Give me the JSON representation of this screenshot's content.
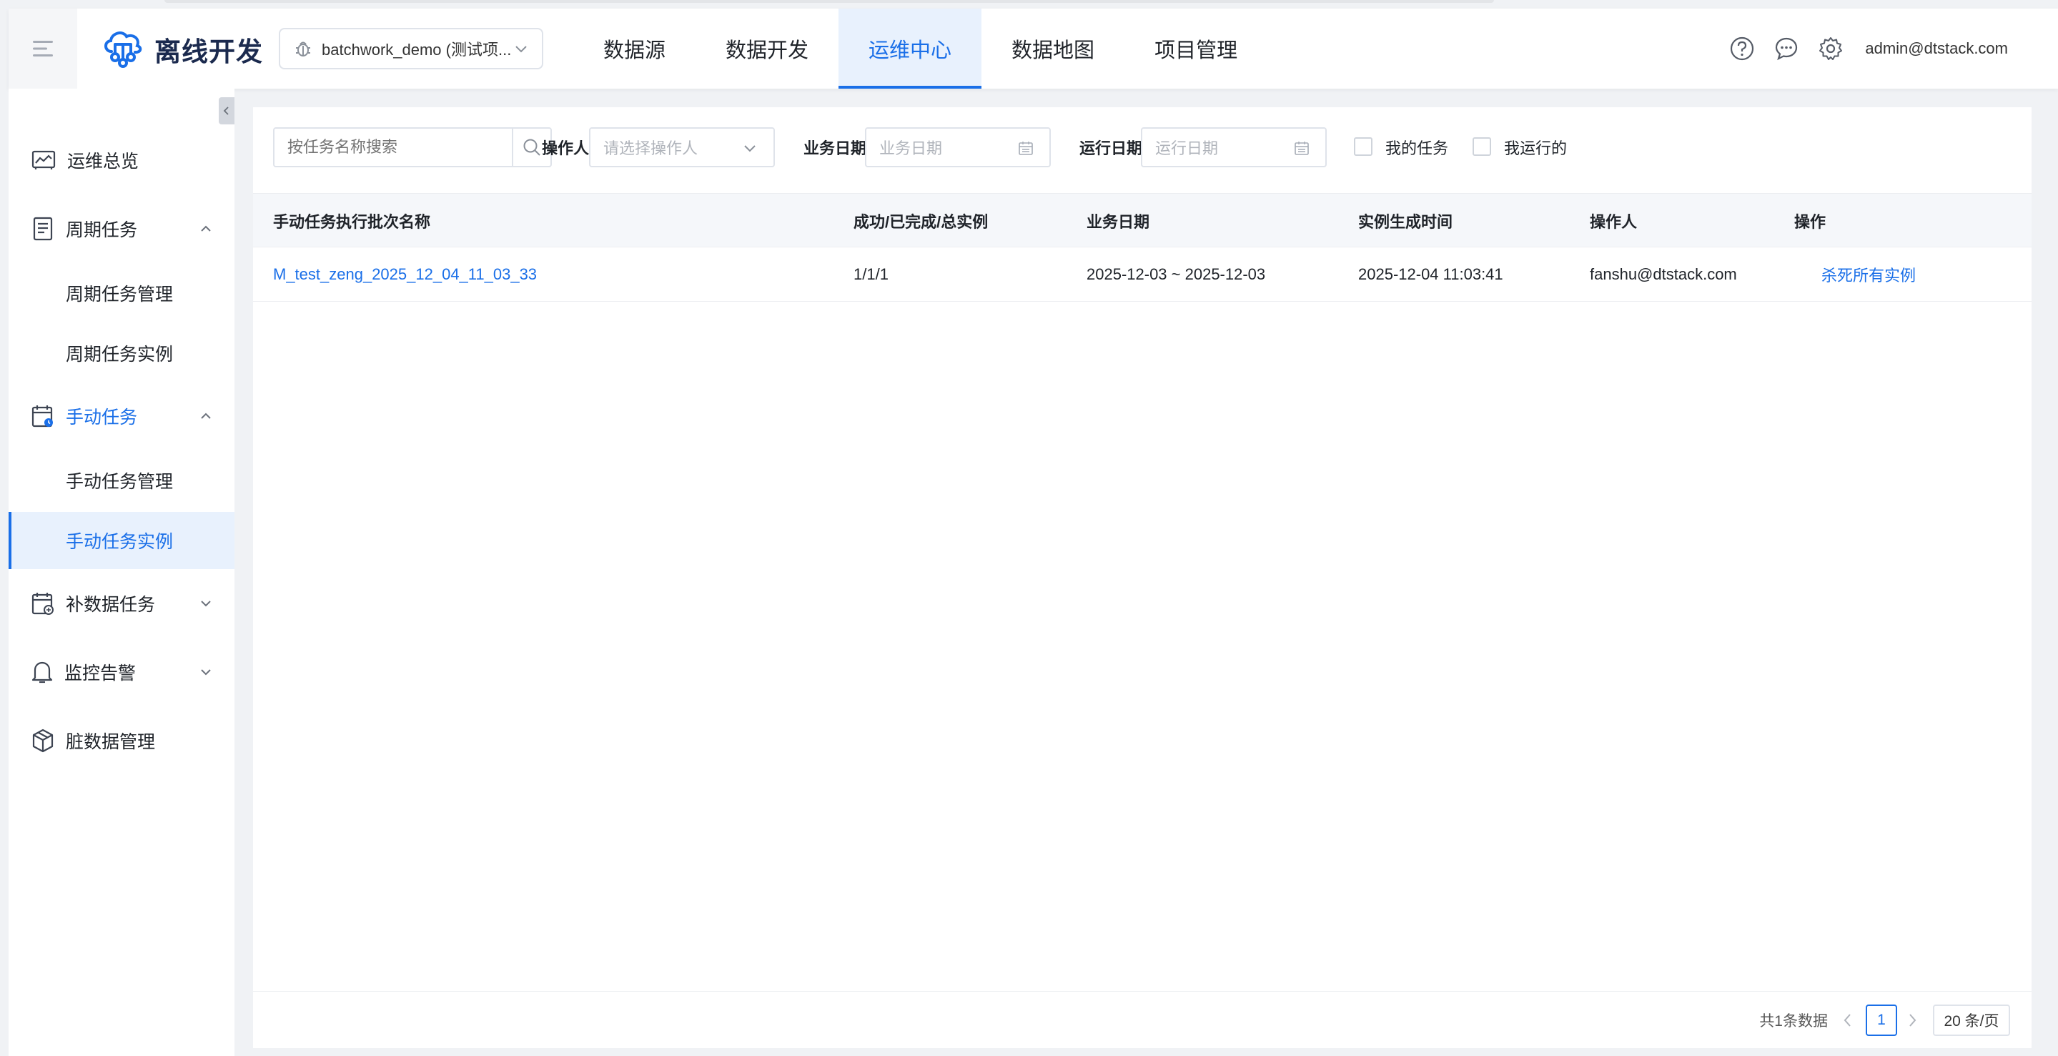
{
  "app": {
    "title": "离线开发"
  },
  "project": {
    "name": "batchwork_demo (测试项..."
  },
  "nav": [
    {
      "label": "数据源"
    },
    {
      "label": "数据开发"
    },
    {
      "label": "运维中心"
    },
    {
      "label": "数据地图"
    },
    {
      "label": "项目管理"
    }
  ],
  "nav_active_index": 2,
  "user": {
    "email": "admin@dtstack.com"
  },
  "sidebar": {
    "overview": "运维总览",
    "periodic": {
      "label": "周期任务",
      "items": [
        "周期任务管理",
        "周期任务实例"
      ]
    },
    "manual": {
      "label": "手动任务",
      "items": [
        "手动任务管理",
        "手动任务实例"
      ]
    },
    "backfill": "补数据任务",
    "alert": "监控告警",
    "dirty": "脏数据管理"
  },
  "filters": {
    "search_placeholder": "按任务名称搜索",
    "operator_label": "操作人",
    "operator_placeholder": "请选择操作人",
    "biz_date_label": "业务日期",
    "biz_date_placeholder": "业务日期",
    "run_date_label": "运行日期",
    "run_date_placeholder": "运行日期",
    "my_tasks": "我的任务",
    "my_runs": "我运行的"
  },
  "table": {
    "columns": [
      "手动任务执行批次名称",
      "成功/已完成/总实例",
      "业务日期",
      "实例生成时间",
      "操作人",
      "操作"
    ],
    "rows": [
      {
        "name": "M_test_zeng_2025_12_04_11_03_33",
        "progress": "1/1/1",
        "biz_date": "2025-12-03 ~ 2025-12-03",
        "created": "2025-12-04 11:03:41",
        "operator": "fanshu@dtstack.com",
        "action": "杀死所有实例"
      }
    ]
  },
  "pagination": {
    "total": "共1条数据",
    "current": "1",
    "page_size": "20 条/页"
  },
  "colors": {
    "primary": "#1a6fe8",
    "bg": "#f0f2f5"
  }
}
